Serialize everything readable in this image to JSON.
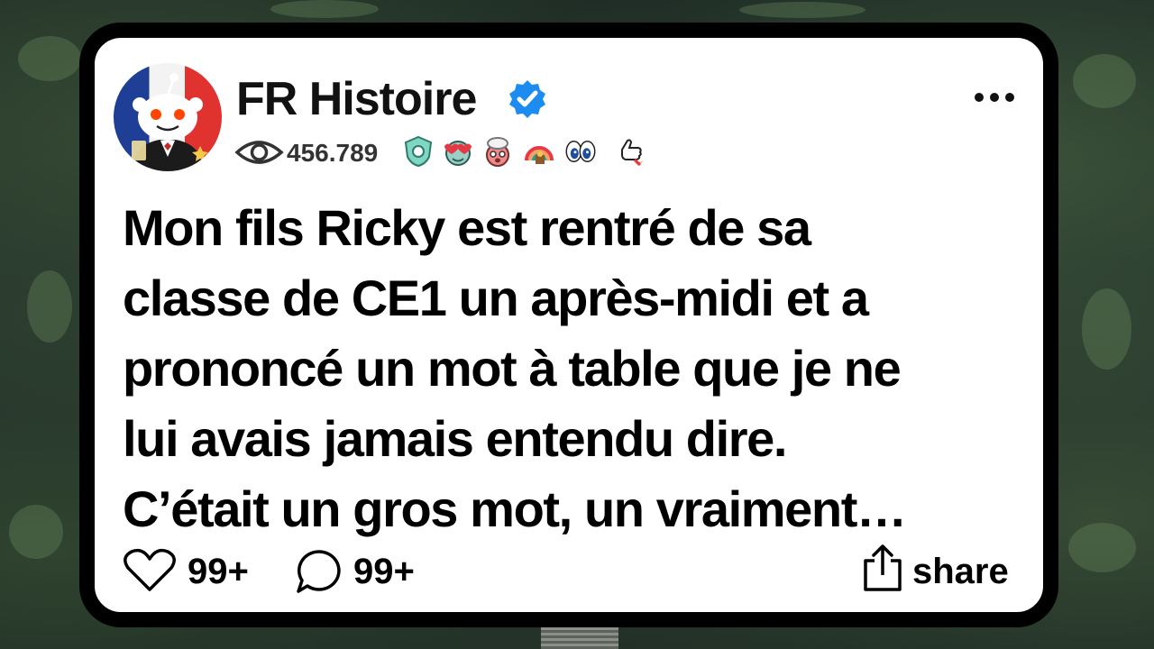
{
  "post": {
    "author": "FR Histoire",
    "views": "456.789",
    "body_lines": [
      "Mon fils Ricky est rentré de sa",
      "classe de CE1 un après-midi et a",
      "prononcé un mot à table que je ne",
      "lui avais jamais entendu dire.",
      "C’était un gros mot, un vraiment…"
    ],
    "likes": "99+",
    "comments": "99+",
    "share_label": "share"
  },
  "icons": {
    "verified": "verified-badge-icon",
    "more": "more-options-icon",
    "views": "eye-icon",
    "like": "heart-icon",
    "comment": "comment-bubble-icon",
    "share": "share-icon",
    "awards": [
      "shield-award-icon",
      "heart-eyes-award-icon",
      "mind-blown-award-icon",
      "rainbow-award-icon",
      "eyes-award-icon",
      "rocket-like-award-icon"
    ]
  },
  "colors": {
    "verified_blue": "#1d8cf0",
    "card_background": "#ffffff",
    "card_border": "#000000"
  }
}
